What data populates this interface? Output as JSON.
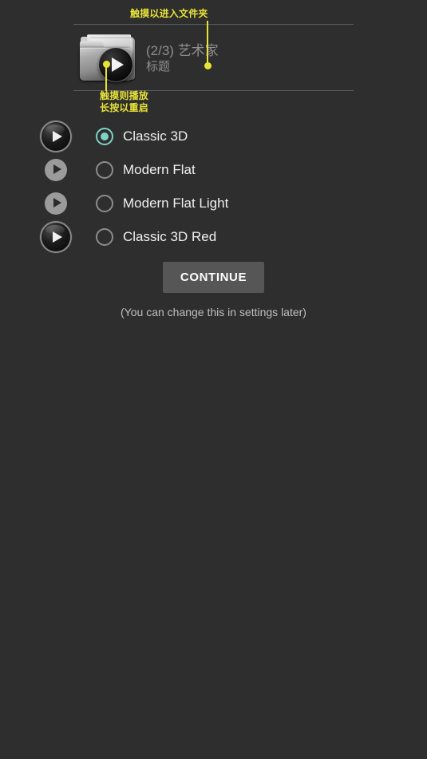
{
  "background_color": "#2e2e2e",
  "accent_color": "#7fd1c8",
  "annotation_color": "#e8e337",
  "preview": {
    "folder_icon": "folder-with-play-icon",
    "line1": "(2/3) 艺术家",
    "line2": "标题",
    "annotations": {
      "top": "触摸以进入文件夹",
      "bottom_line1": "触摸则播放",
      "bottom_line2": "长按以重启"
    }
  },
  "options": [
    {
      "label": "Classic 3D",
      "icon": "play-button-classic-3d-icon",
      "style": "classic3d",
      "selected": true
    },
    {
      "label": "Modern Flat",
      "icon": "play-button-modern-flat-icon",
      "style": "flat",
      "selected": false
    },
    {
      "label": "Modern Flat Light",
      "icon": "play-button-modern-flat-light-icon",
      "style": "flat",
      "selected": false
    },
    {
      "label": "Classic 3D Red",
      "icon": "play-button-classic-3d-red-icon",
      "style": "classic3d",
      "selected": false
    }
  ],
  "footer": {
    "continue_label": "CONTINUE",
    "hint": "(You can change this in settings later)"
  }
}
